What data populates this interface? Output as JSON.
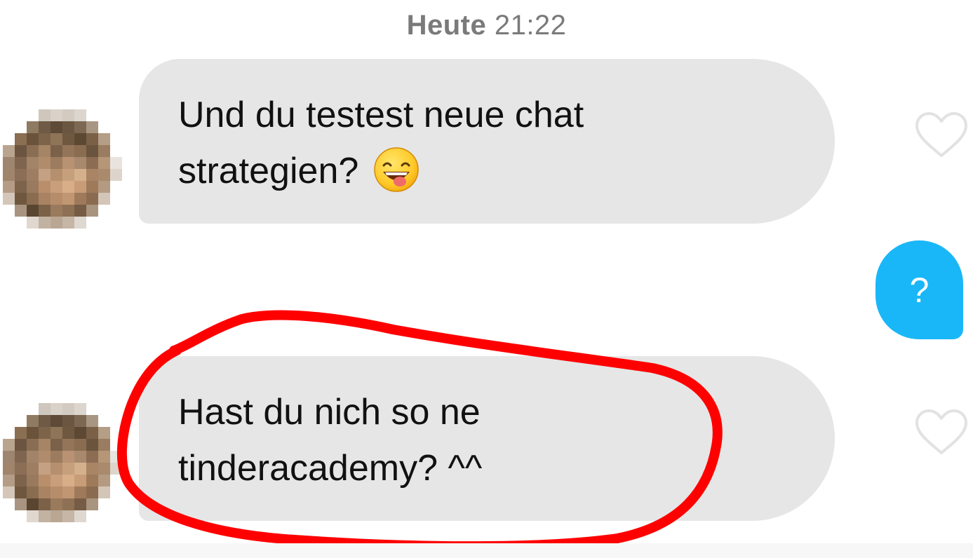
{
  "timestamp": {
    "day": "Heute",
    "time": "21:22"
  },
  "messages": [
    {
      "direction": "incoming",
      "line1": "Und du testest neue chat",
      "line2": "strategien?",
      "emoji": "grinning-squinting-tongue-emoji"
    },
    {
      "direction": "outgoing",
      "text": "?"
    },
    {
      "direction": "incoming",
      "line1": "Hast du nich so ne",
      "line2": "tinderacademy? ^^"
    }
  ],
  "icons": {
    "like": "heart-outline-icon"
  },
  "colors": {
    "incoming_bubble": "#e6e6e6",
    "outgoing_bubble": "#1ab7f8",
    "timestamp_text": "#7a7a7a",
    "annotation": "#ff0000"
  }
}
